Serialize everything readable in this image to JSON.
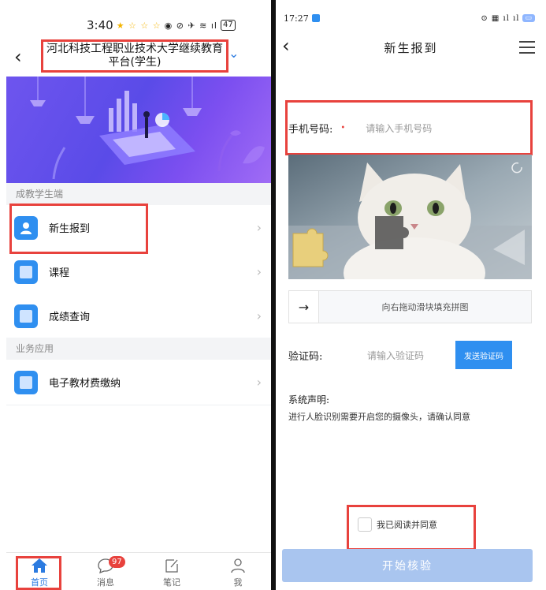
{
  "left": {
    "status": {
      "time": "3:40",
      "battery": "47"
    },
    "header": {
      "title": "河北科技工程职业技术大学继续教育平台(学生)"
    },
    "sections": [
      {
        "label": "成教学生端"
      },
      {
        "label": "业务应用"
      }
    ],
    "items": [
      {
        "label": "新生报到",
        "icon": "person-icon"
      },
      {
        "label": "课程",
        "icon": "book-icon"
      },
      {
        "label": "成绩查询",
        "icon": "book-icon"
      },
      {
        "label": "电子教材费缴纳",
        "icon": "book-icon"
      }
    ],
    "tabbar": [
      {
        "label": "首页",
        "icon": "home-icon"
      },
      {
        "label": "消息",
        "icon": "chat-icon",
        "badge": "97"
      },
      {
        "label": "笔记",
        "icon": "note-icon"
      },
      {
        "label": "我",
        "icon": "user-icon"
      }
    ]
  },
  "right": {
    "status": {
      "time": "17:27"
    },
    "header": {
      "title": "新生报到"
    },
    "phone": {
      "label": "手机号码:",
      "required_mark": "•",
      "placeholder": "请输入手机号码"
    },
    "slider": {
      "hint": "向右拖动滑块填充拼图",
      "knob": "→"
    },
    "code": {
      "label": "验证码:",
      "placeholder": "请输入验证码",
      "send_label": "发送验证码"
    },
    "declaration": {
      "title": "系统声明:",
      "text": "进行人脸识别需要开启您的摄像头，请确认同意"
    },
    "agree": {
      "label": "我已阅读并同意"
    },
    "start": {
      "label": "开始核验"
    }
  },
  "colors": {
    "accent": "#2f8ff0",
    "highlight": "#e8423d",
    "start_disabled": "#a9c5ef"
  }
}
